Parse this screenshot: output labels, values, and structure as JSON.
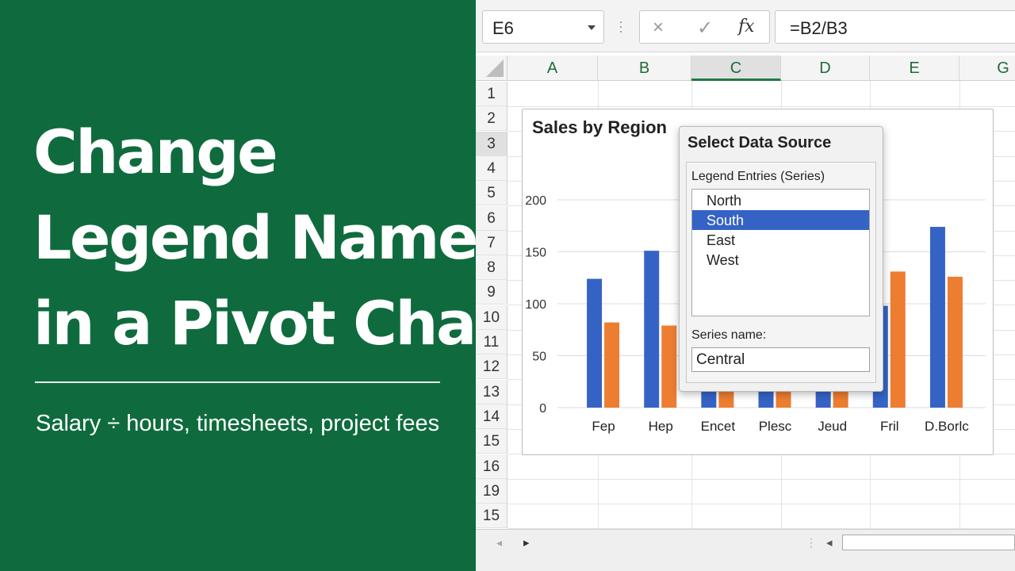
{
  "banner": {
    "title_lines": [
      "Change",
      "Legend Name",
      "in a Pivot Chart"
    ],
    "subtitle": "Salary ÷ hours, timesheets, project fees"
  },
  "formula_bar": {
    "name_box": "E6",
    "cancel_icon": "×",
    "enter_icon": "✓",
    "fx_label": "fx",
    "formula": "=B2/B3"
  },
  "sheet": {
    "columns": [
      "A",
      "B",
      "C",
      "D",
      "E",
      "G"
    ],
    "selected_column": "C",
    "rows": [
      "1",
      "2",
      "3",
      "4",
      "5",
      "6",
      "7",
      "8",
      "9",
      "10",
      "11",
      "12",
      "13",
      "14",
      "15",
      "16",
      "19",
      "15"
    ],
    "selected_row": "3"
  },
  "chart_data": {
    "type": "bar",
    "title": "Sales by Region",
    "categories": [
      "Fep",
      "Hep",
      "Encet",
      "Plesc",
      "Jeud",
      "Fril",
      "D.Borlc"
    ],
    "series": [
      {
        "color": "#3563c5",
        "values": [
          124,
          151,
          120,
          110,
          98,
          98,
          174
        ]
      },
      {
        "color": "#ed7d31",
        "values": [
          82,
          79,
          90,
          85,
          95,
          131,
          126
        ]
      }
    ],
    "yticks": [
      0,
      50,
      100,
      150,
      200
    ],
    "ylim": [
      0,
      200
    ],
    "grid": true
  },
  "dialog": {
    "title": "Select Data Source",
    "legend_label": "Legend Entries (Series)",
    "series_items": [
      "North",
      "South",
      "East",
      "West"
    ],
    "selected_index": 1,
    "series_name_label": "Series name:",
    "series_name_value": "Central"
  },
  "status": {
    "nav_prev": "◂",
    "nav_next": "▸",
    "scroll_dots": "⋮",
    "scroll_left": "◂"
  }
}
